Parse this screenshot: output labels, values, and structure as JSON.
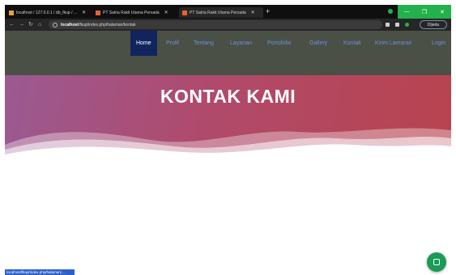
{
  "browser": {
    "tabs": [
      {
        "label": "localhost / 127.0.0.1 / db_fkup / ...",
        "favicon_color": "#e8a33a"
      },
      {
        "label": "PT Satria Rakit Utama Persada",
        "favicon_color": "#e8622d"
      },
      {
        "label": "PT Satria Rakit Utama Persada",
        "favicon_color": "#e8622d"
      }
    ],
    "new_tab": "+",
    "window_controls": {
      "minimize": "—",
      "maximize": "❐",
      "close": "✕"
    },
    "address": {
      "host": "localhost",
      "path": "/fkup/index.php/halaman/kontak"
    },
    "profile_label": "Dijeda",
    "status_url": "localhost/fkup/index.php/halaman/..."
  },
  "site_nav": {
    "items": [
      {
        "label": "Home",
        "active": true
      },
      {
        "label": "Profil",
        "active": false
      },
      {
        "label": "Tentang",
        "active": false
      },
      {
        "label": "Layanan",
        "active": false
      },
      {
        "label": "Portofolio",
        "active": false
      },
      {
        "label": "Gallery",
        "active": false
      },
      {
        "label": "Kontak",
        "active": false
      },
      {
        "label": "Kirim Lamaran",
        "active": false
      },
      {
        "label": "Login",
        "active": false
      }
    ]
  },
  "hero": {
    "title": "KONTAK KAMI"
  },
  "colors": {
    "nav_bg": "#4a5045",
    "nav_active_bg": "#11255d",
    "nav_link": "#6f8fe0",
    "hero_gradient_start": "#9a5a92",
    "hero_gradient_end": "#b8434e",
    "fab": "#1a9b56"
  },
  "icons": {
    "fab": "chat-icon",
    "info": "info-icon"
  }
}
